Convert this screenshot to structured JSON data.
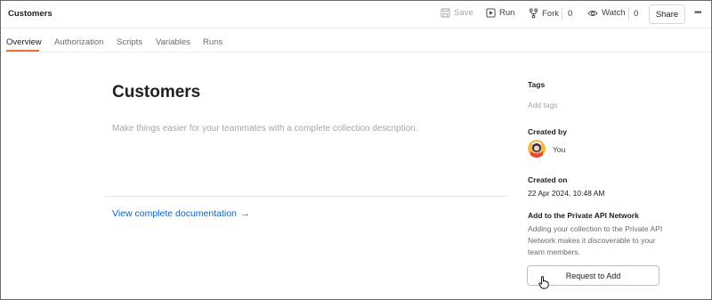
{
  "header": {
    "title": "Customers",
    "save_label": "Save",
    "run_label": "Run",
    "fork_label": "Fork",
    "fork_count": "0",
    "watch_label": "Watch",
    "watch_count": "0",
    "share_label": "Share",
    "more_icon": "more-horizontal-icon"
  },
  "tabs": [
    {
      "label": "Overview",
      "active": true
    },
    {
      "label": "Authorization",
      "active": false
    },
    {
      "label": "Scripts",
      "active": false
    },
    {
      "label": "Variables",
      "active": false
    },
    {
      "label": "Runs",
      "active": false
    }
  ],
  "main": {
    "collection_name": "Customers",
    "description_placeholder": "Make things easier for your teammates with a complete collection description.",
    "view_docs_label": "View complete documentation",
    "view_docs_arrow": "→"
  },
  "sidebar": {
    "tags_heading": "Tags",
    "add_tags": "Add tags",
    "created_by_heading": "Created by",
    "created_by_user": "You",
    "created_on_heading": "Created on",
    "created_on_value": "22 Apr 2024, 10:48 AM",
    "network_heading": "Add to the Private API Network",
    "network_text": "Adding your collection to the Private API Network makes it discoverable to your team members.",
    "request_button": "Request to Add"
  },
  "colors": {
    "accent": "#f26b3a",
    "link": "#0b63c8",
    "muted": "#a6a6a6"
  }
}
